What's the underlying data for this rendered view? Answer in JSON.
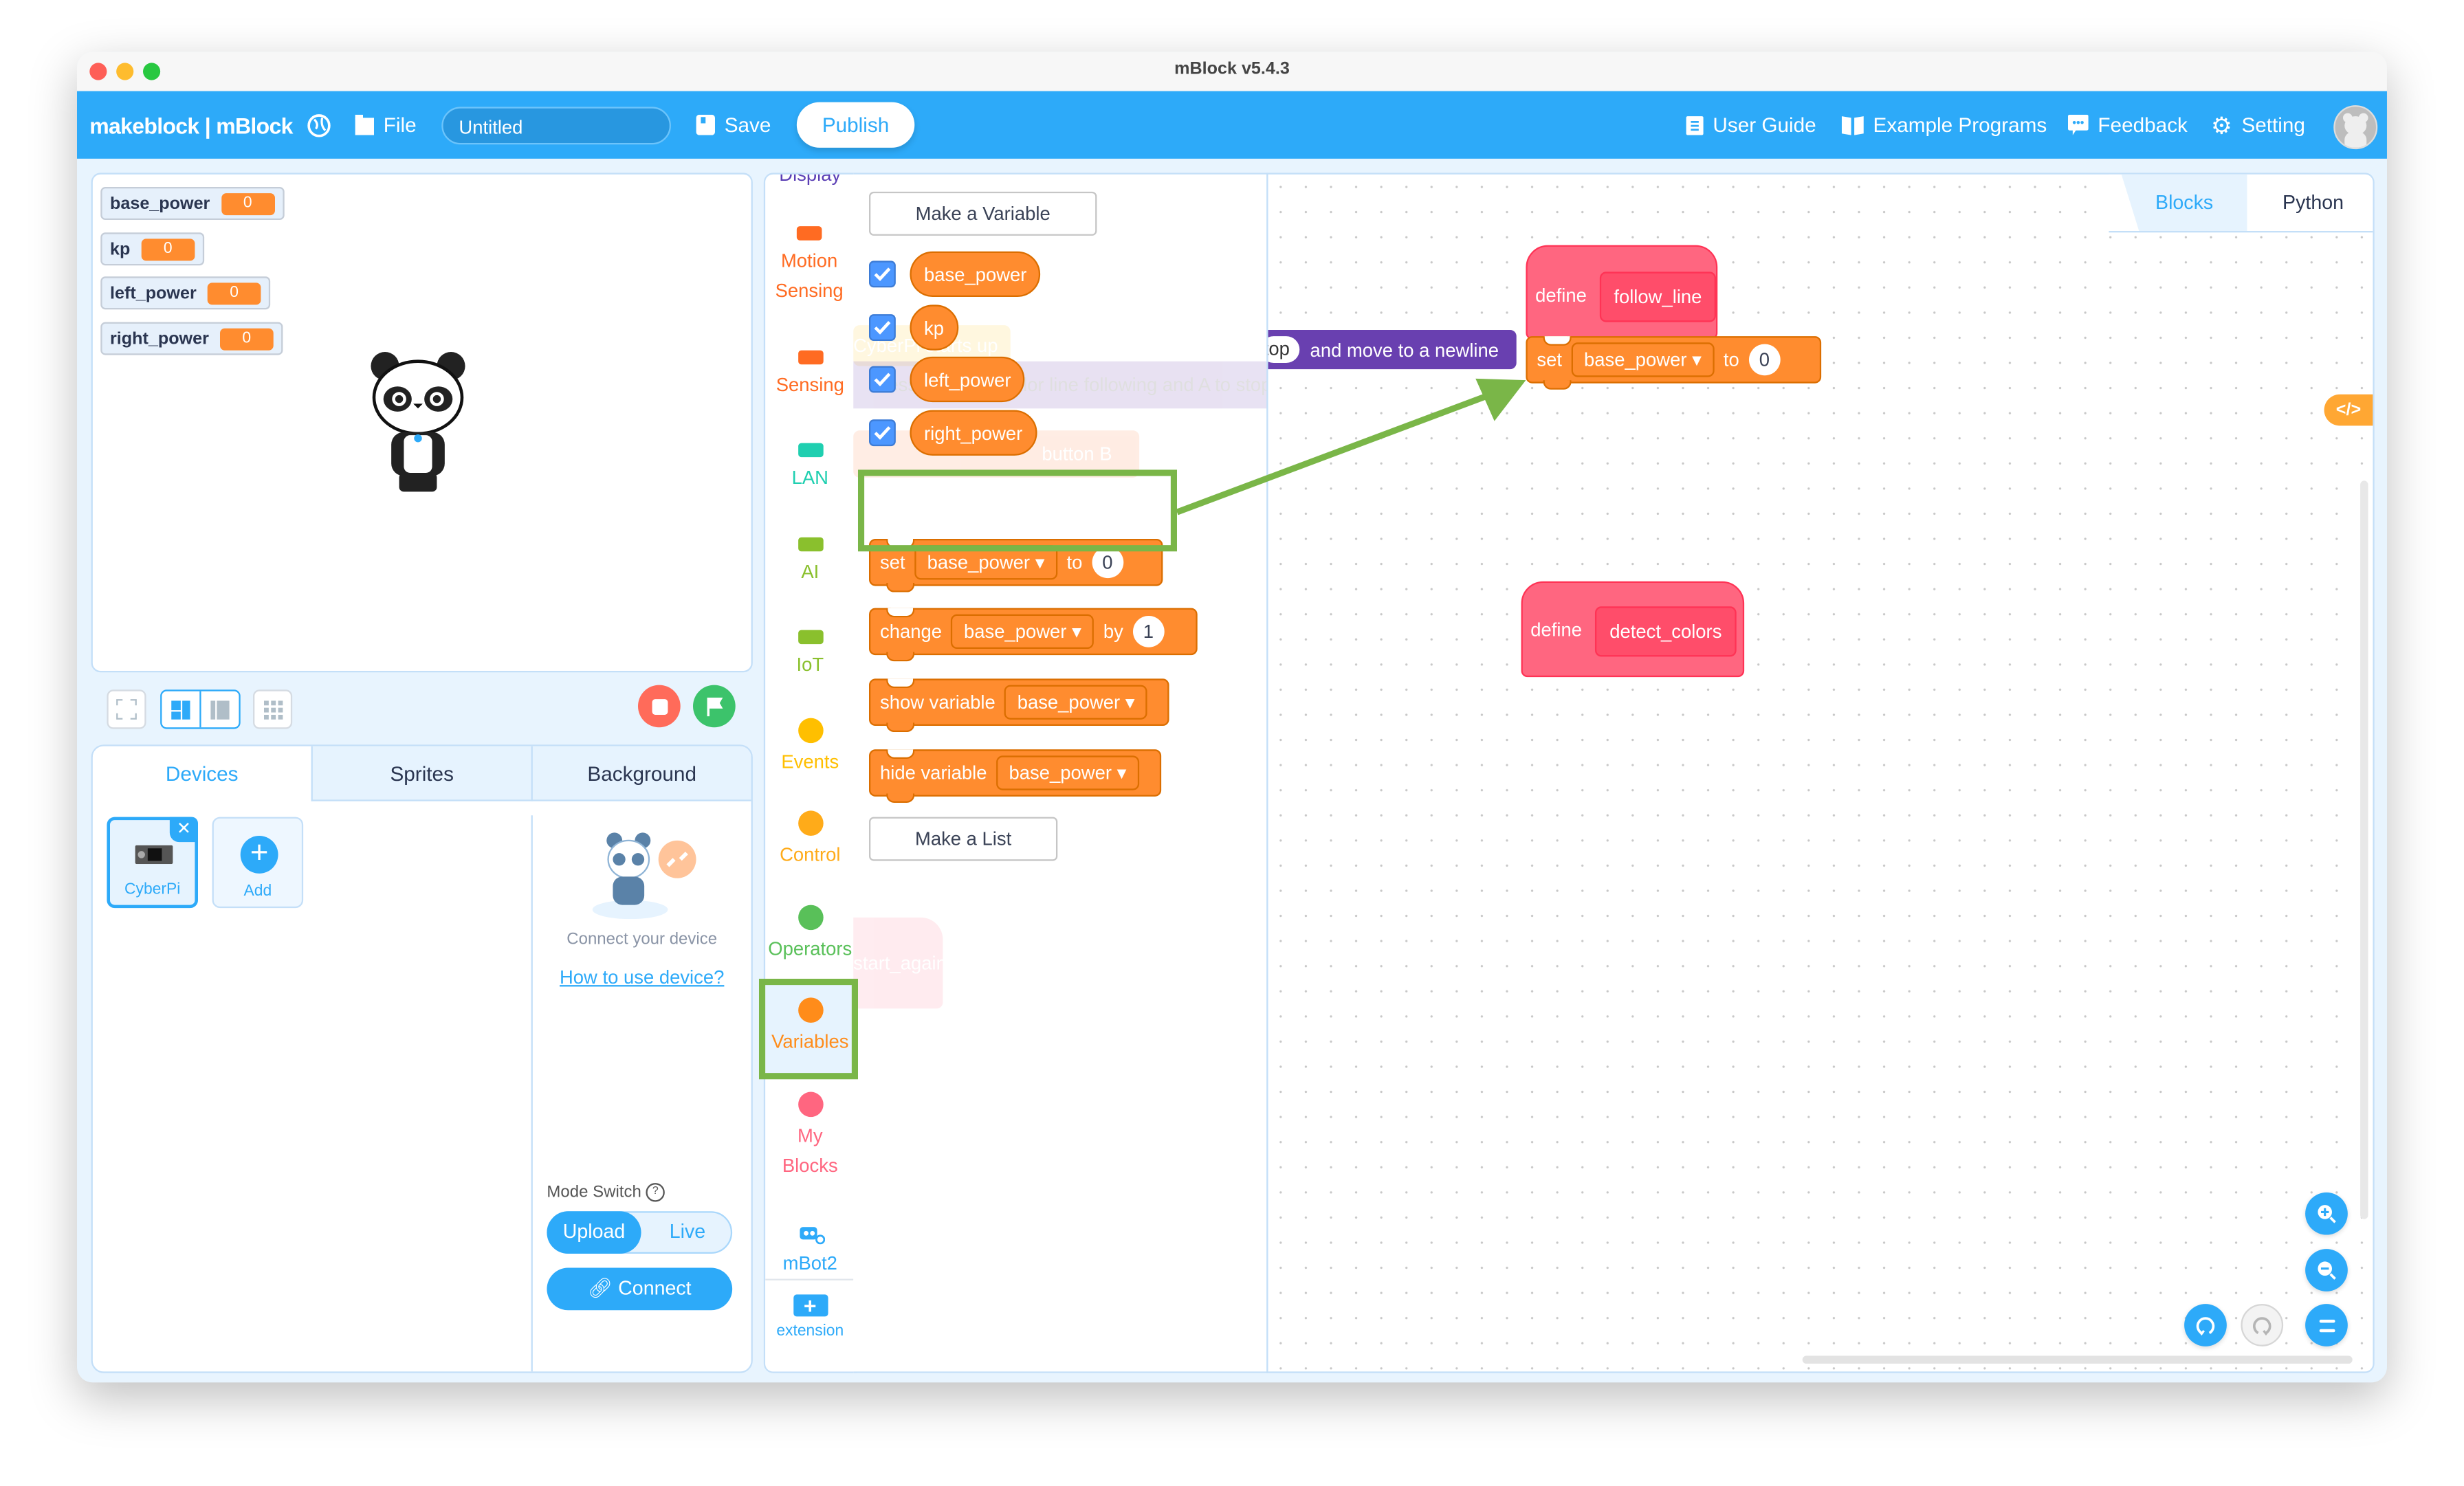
{
  "window": {
    "title": "mBlock v5.4.3"
  },
  "topbar": {
    "logo": "makeblock | mBlock",
    "file_label": "File",
    "project_name": "Untitled",
    "save_label": "Save",
    "publish_label": "Publish",
    "user_guide_label": "User Guide",
    "examples_label": "Example Programs",
    "feedback_label": "Feedback",
    "setting_label": "Setting"
  },
  "stage": {
    "monitors": [
      {
        "name": "base_power",
        "value": "0"
      },
      {
        "name": "kp",
        "value": "0"
      },
      {
        "name": "left_power",
        "value": "0"
      },
      {
        "name": "right_power",
        "value": "0"
      }
    ]
  },
  "panel": {
    "tabs": [
      {
        "label": "Devices",
        "active": true
      },
      {
        "label": "Sprites",
        "active": false
      },
      {
        "label": "Background",
        "active": false
      }
    ],
    "devices": [
      {
        "label": "CyberPi"
      }
    ],
    "add_label": "Add",
    "connect_hint": "Connect your device",
    "howto_link": "How to use device?",
    "mode_switch_label": "Mode Switch",
    "mode_options": [
      "Upload",
      "Live"
    ],
    "mode_selected": "Upload",
    "connect_label": "Connect"
  },
  "categories": [
    {
      "label": "Display",
      "color": "#5b3fb5"
    },
    {
      "label": "Motion Sensing",
      "color": "#ff6b22"
    },
    {
      "label": "Sensing",
      "color": "#ff6b22"
    },
    {
      "label": "LAN",
      "color": "#1fcfb0"
    },
    {
      "label": "AI",
      "color": "#8ac02d"
    },
    {
      "label": "IoT",
      "color": "#8ac02d"
    },
    {
      "label": "Events",
      "color": "#ffbf00"
    },
    {
      "label": "Control",
      "color": "#ffab19"
    },
    {
      "label": "Operators",
      "color": "#59c059"
    },
    {
      "label": "Variables",
      "color": "#ff8c1a",
      "selected": true
    },
    {
      "label": "My Blocks",
      "color": "#ff6680"
    },
    {
      "label": "mBot2",
      "color": "#2daaf9"
    },
    {
      "label": "extension",
      "color": "#2daaf9"
    }
  ],
  "palette": {
    "make_variable": "Make a Variable",
    "variables": [
      {
        "name": "base_power",
        "checked": true
      },
      {
        "name": "kp",
        "checked": true
      },
      {
        "name": "left_power",
        "checked": true
      },
      {
        "name": "right_power",
        "checked": true
      }
    ],
    "blocks": {
      "set": {
        "verb": "set",
        "var": "base_power",
        "prep": "to",
        "value": "0"
      },
      "change": {
        "verb": "change",
        "var": "base_power",
        "prep": "by",
        "value": "1"
      },
      "show": {
        "verb": "show variable",
        "var": "base_power"
      },
      "hide": {
        "verb": "hide variable",
        "var": "base_power"
      }
    },
    "make_list": "Make a List",
    "ghost_texts": [
      "CyberPi starts up",
      "Press B to start color line following and A to stop",
      "button B pressed?",
      "start_again"
    ]
  },
  "canvas": {
    "tabs": [
      {
        "label": "Blocks",
        "active": true
      },
      {
        "label": "Python",
        "active": false
      }
    ],
    "purple_block": {
      "value": "top",
      "text": "and move to a newline"
    },
    "define1": {
      "keyword": "define",
      "name": "follow_line"
    },
    "set_block": {
      "verb": "set",
      "var": "base_power",
      "prep": "to",
      "value": "0"
    },
    "define2": {
      "keyword": "define",
      "name": "detect_colors"
    }
  },
  "colors": {
    "accent": "#2daaf9",
    "variables": "#ff8c2f",
    "myblocks": "#ff6680",
    "highlight": "#7ab648"
  }
}
